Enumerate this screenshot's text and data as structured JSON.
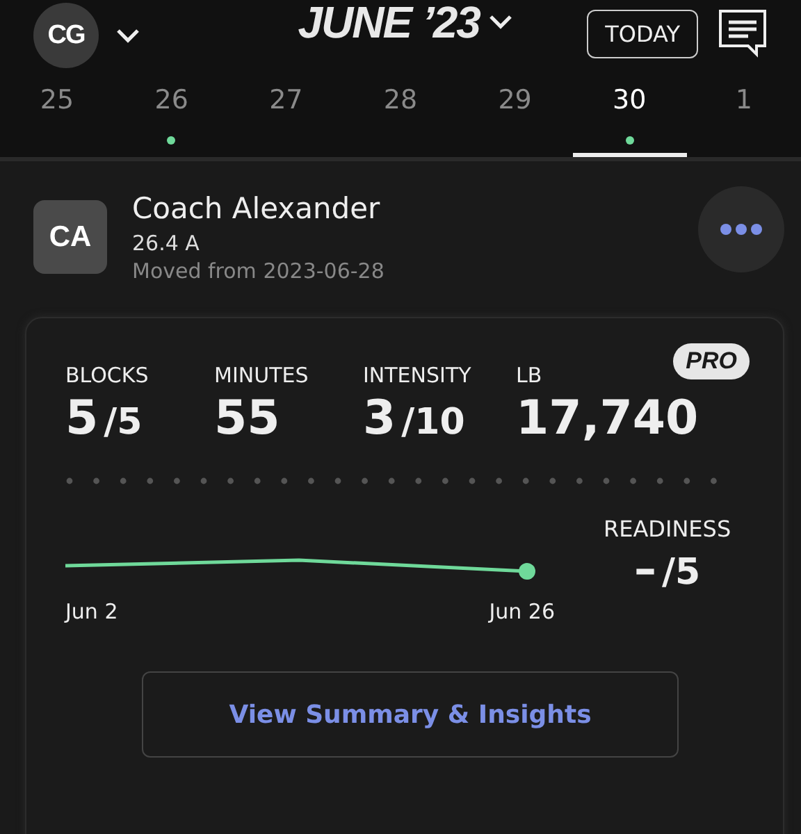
{
  "header": {
    "user_initials": "CG",
    "month_title": "JUNE ’23",
    "today_button": "TODAY"
  },
  "days": [
    {
      "label": "25",
      "selected": false,
      "has_event": false
    },
    {
      "label": "26",
      "selected": false,
      "has_event": true
    },
    {
      "label": "27",
      "selected": false,
      "has_event": false
    },
    {
      "label": "28",
      "selected": false,
      "has_event": false
    },
    {
      "label": "29",
      "selected": false,
      "has_event": false
    },
    {
      "label": "30",
      "selected": true,
      "has_event": true
    },
    {
      "label": "1",
      "selected": false,
      "has_event": false
    }
  ],
  "session": {
    "coach_initials": "CA",
    "coach_name": "Coach Alexander",
    "code": "26.4 A",
    "note": "Moved from 2023-06-28"
  },
  "summary": {
    "badge": "PRO",
    "stats": [
      {
        "label": "BLOCKS",
        "value": "5",
        "denominator": "/5"
      },
      {
        "label": "MINUTES",
        "value": "55"
      },
      {
        "label": "INTENSITY",
        "value": "3",
        "denominator": "/10"
      },
      {
        "label": "LB",
        "value": "17,740"
      }
    ],
    "trend": {
      "start_label": "Jun 2",
      "end_label": "Jun 26"
    },
    "readiness": {
      "label": "READINESS",
      "value": "–",
      "denominator": "/5"
    },
    "button": "View Summary & Insights"
  }
}
